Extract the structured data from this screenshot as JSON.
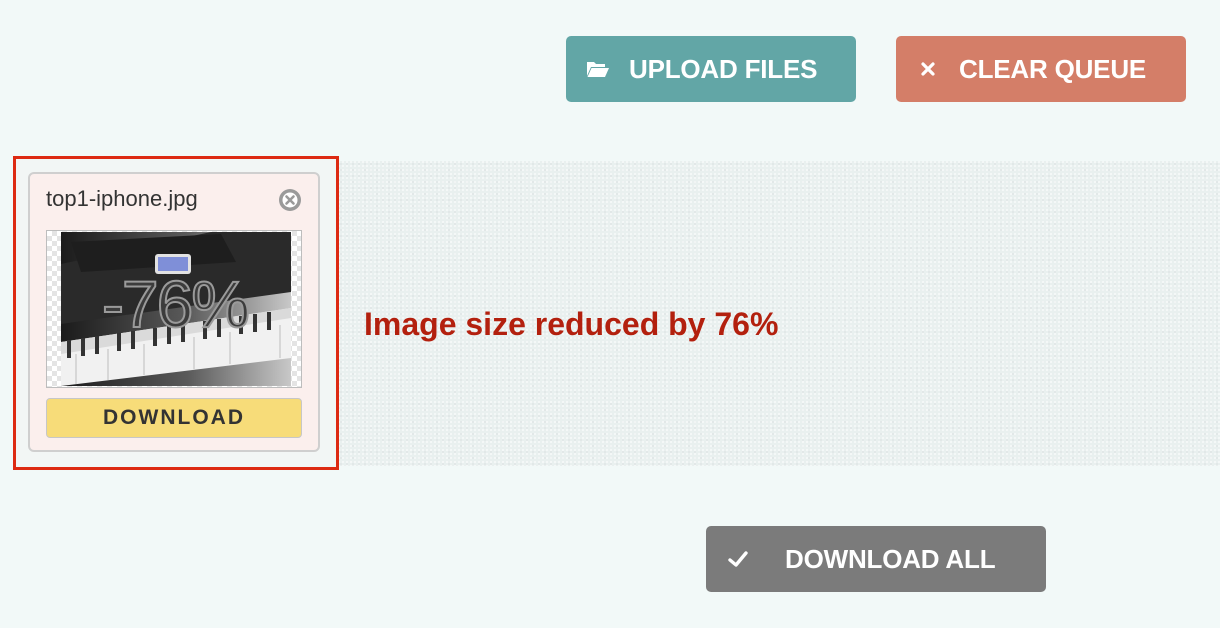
{
  "toolbar": {
    "upload_label": "UPLOAD FILES",
    "upload_icon": "folder-open-icon",
    "clear_label": "CLEAR QUEUE",
    "clear_icon": "close-icon"
  },
  "queue": {
    "items": [
      {
        "file_name": "top1-iphone.jpg",
        "reduction_badge": "-76%",
        "download_label": "DOWNLOAD",
        "remove_icon": "remove-circle-icon",
        "thumbnail": "piano-with-phone-image"
      }
    ],
    "result_message": "Image size reduced by 76%"
  },
  "footer": {
    "download_all_label": "DOWNLOAD ALL",
    "download_all_icon": "checkmark-icon"
  },
  "colors": {
    "upload_button": "#62a6a6",
    "clear_button": "#d47e68",
    "download_all_button": "#7b7b7b",
    "card_download_button": "#f7dc79",
    "result_text": "#b3200e",
    "highlight_border": "#dd2a12",
    "page_background": "#f2f9f8"
  }
}
